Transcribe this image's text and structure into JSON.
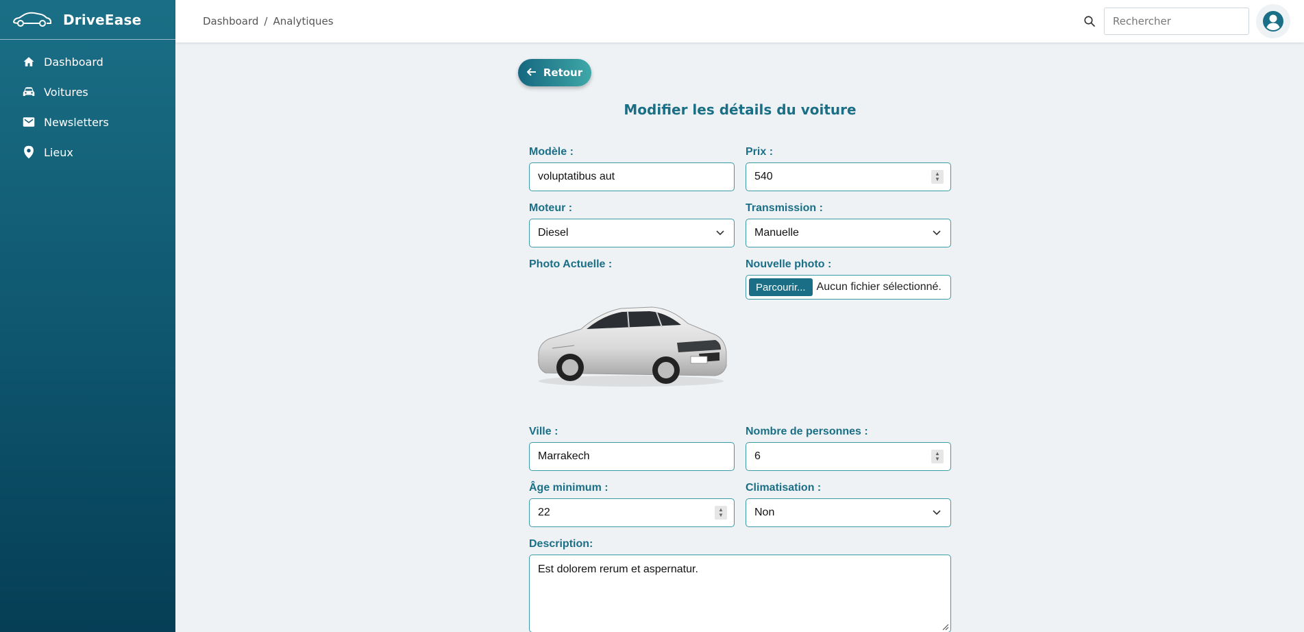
{
  "app": {
    "name": "DriveEase"
  },
  "sidebar": {
    "items": [
      {
        "label": "Dashboard",
        "icon": "home-icon"
      },
      {
        "label": "Voitures",
        "icon": "car-icon"
      },
      {
        "label": "Newsletters",
        "icon": "mail-icon"
      },
      {
        "label": "Lieux",
        "icon": "location-pin-icon"
      }
    ]
  },
  "header": {
    "breadcrumb": [
      "Dashboard",
      "/",
      "Analytiques"
    ],
    "search_placeholder": "Rechercher"
  },
  "main": {
    "back_label": "Retour",
    "title": "Modifier les détails du voiture",
    "fields": {
      "modele": {
        "label": "Modèle :",
        "value": "voluptatibus aut"
      },
      "prix": {
        "label": "Prix :",
        "value": "540"
      },
      "moteur": {
        "label": "Moteur :",
        "value": "Diesel"
      },
      "transmission": {
        "label": "Transmission :",
        "value": "Manuelle"
      },
      "photo_actuelle": {
        "label": "Photo Actuelle :"
      },
      "nouvelle_photo": {
        "label": "Nouvelle photo :",
        "button": "Parcourir...",
        "status": "Aucun fichier sélectionné."
      },
      "ville": {
        "label": "Ville :",
        "value": "Marrakech"
      },
      "personnes": {
        "label": "Nombre de personnes :",
        "value": "6"
      },
      "age": {
        "label": "Âge minimum :",
        "value": "22"
      },
      "climatisation": {
        "label": "Climatisation :",
        "value": "Non"
      },
      "description": {
        "label": "Description:",
        "value": "Est dolorem rerum et aspernatur."
      }
    }
  },
  "colors": {
    "accent": "#1a6f86",
    "border": "#3a9aa5",
    "background": "#eef2f5"
  }
}
